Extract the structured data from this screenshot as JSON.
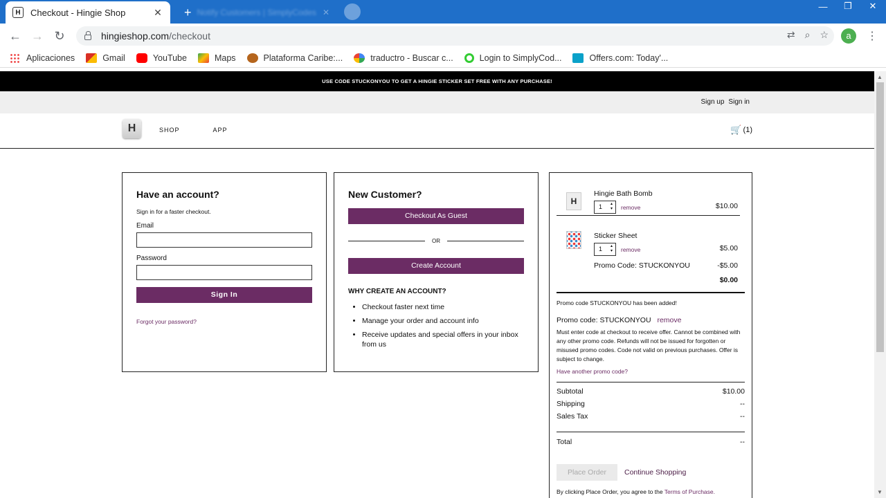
{
  "browser": {
    "active_tab_title": "Checkout - Hingie Shop",
    "active_tab_favicon": "H",
    "inactive_tab_title": "Notify Customers | SimplyCodes",
    "url_host": "hingieshop.com",
    "url_path": "/checkout",
    "profile_initial": "a",
    "bookmarks": [
      {
        "label": "Aplicaciones",
        "icon": "apps-grid-icon",
        "color": "#e44"
      },
      {
        "label": "Gmail",
        "icon": "gmail-icon",
        "color": "#d93025"
      },
      {
        "label": "YouTube",
        "icon": "youtube-icon",
        "color": "#ff0000"
      },
      {
        "label": "Maps",
        "icon": "maps-icon",
        "color": "#34a853"
      },
      {
        "label": "Plataforma Caribe:...",
        "icon": "plataforma-icon",
        "color": "#b5651d"
      },
      {
        "label": "traductro - Buscar c...",
        "icon": "google-icon",
        "color": "#4285f4"
      },
      {
        "label": "Login to SimplyCod...",
        "icon": "simplycodes-icon",
        "color": "#33cc33"
      },
      {
        "label": "Offers.com: Today'...",
        "icon": "offers-icon",
        "color": "#0aa1c9"
      }
    ]
  },
  "site": {
    "promo_banner": "USE CODE STUCKONYOU TO GET A HINGIE STICKER SET FREE WITH ANY PURCHASE!",
    "sign_up": "Sign up",
    "sign_in": "Sign in",
    "logo_text": "H",
    "nav": [
      "SHOP",
      "APP"
    ],
    "cart_count": "(1)",
    "accent": "#6b2c64"
  },
  "login": {
    "title": "Have an account?",
    "subtitle": "Sign in for a faster checkout.",
    "email_label": "Email",
    "email_value": "",
    "password_label": "Password",
    "password_value": "",
    "sign_in_button": "Sign In",
    "forgot": "Forgot your password?"
  },
  "new_customer": {
    "title": "New Customer?",
    "guest_button": "Checkout As Guest",
    "or": "OR",
    "create_button": "Create Account",
    "why_title": "WHY CREATE AN ACCOUNT?",
    "reasons": [
      "Checkout faster next time",
      "Manage your order and account info",
      "Receive updates and special offers in your inbox from us"
    ]
  },
  "summary": {
    "items": [
      {
        "name": "Hingie Bath Bomb",
        "qty": "1",
        "remove": "remove",
        "price": "$10.00"
      },
      {
        "name": "Sticker Sheet",
        "qty": "1",
        "remove": "remove",
        "price": "$5.00"
      }
    ],
    "promo_line_label": "Promo Code: STUCKONYOU",
    "promo_line_amount": "-$5.00",
    "promo_item_total": "$0.00",
    "added_msg": "Promo code STUCKONYOU has been added!",
    "applied_label": "Promo code: STUCKONYOU",
    "applied_remove": "remove",
    "terms": "Must enter code at checkout to receive offer. Cannot be combined with any other promo code. Refunds will not be issued for forgotten or misused promo codes. Code not valid on previous purchases. Offer is subject to change.",
    "another_code": "Have another promo code?",
    "subtotal_label": "Subtotal",
    "subtotal_value": "$10.00",
    "shipping_label": "Shipping",
    "shipping_value": "--",
    "tax_label": "Sales Tax",
    "tax_value": "--",
    "total_label": "Total",
    "total_value": "--",
    "place_order": "Place Order",
    "continue_shopping": "Continue Shopping",
    "agree_text": "By clicking Place Order, you agree to the",
    "agree_link": "Terms of Purchase."
  }
}
